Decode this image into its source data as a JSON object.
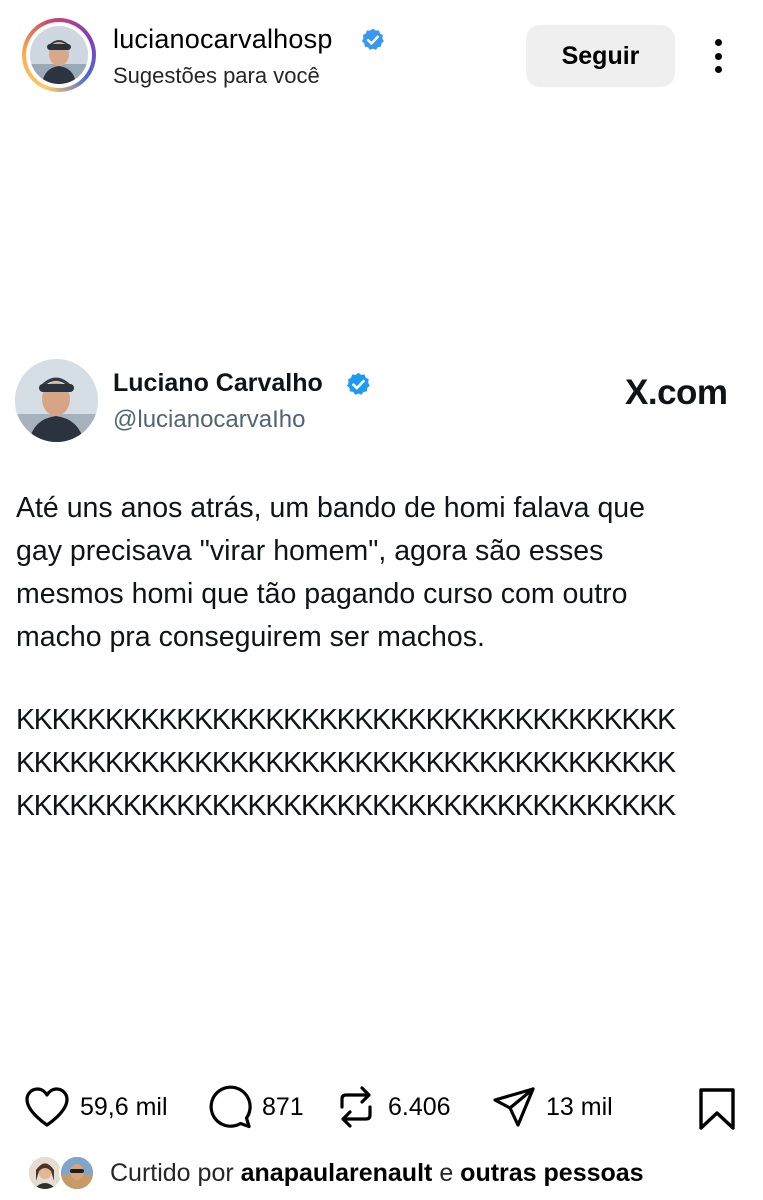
{
  "post_header": {
    "username": "lucianocarvalhosp",
    "subtitle": "Sugestões para você",
    "follow_label": "Seguir"
  },
  "tweet": {
    "display_name": "Luciano Carvalho",
    "handle": "@lucianocarvaIho",
    "source": "X.com",
    "text": "Até uns anos atrás, um bando de homi falava que\ngay precisava \"virar homem\", agora são esses\nmesmos homi que tão pagando curso com outro\nmacho pra conseguirem ser machos.",
    "laugh": "KKKKKKKKKKKKKKKKKKKKKKKKKKKKKKKKKKKKK\nKKKKKKKKKKKKKKKKKKKKKKKKKKKKKKKKKKKKK\nKKKKKKKKKKKKKKKKKKKKKKKKKKKKKKKKKKKKK"
  },
  "actions": {
    "likes": "59,6 mil",
    "comments": "871",
    "reposts": "6.406",
    "shares": "13 mil"
  },
  "liked_by": {
    "prefix": "Curtido por",
    "user": "anapaularenault",
    "conjunction": "e",
    "others": "outras pessoas"
  },
  "icons": {
    "verified_color": "#3897f0",
    "tweet_verified_color": "#1d9bf0"
  }
}
